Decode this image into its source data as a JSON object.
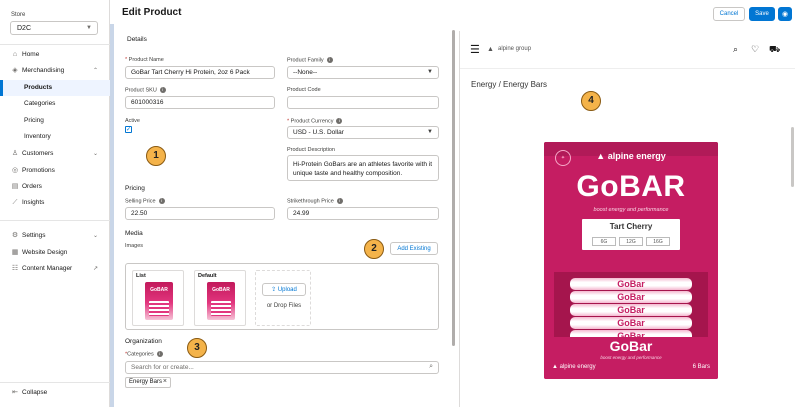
{
  "sidebar": {
    "store_label": "Store",
    "store_value": "D2C",
    "items": [
      {
        "label": "Home",
        "icon": "home-icon"
      },
      {
        "label": "Merchandising",
        "icon": "tag-icon"
      },
      {
        "label": "Customers",
        "icon": "people-icon"
      },
      {
        "label": "Promotions",
        "icon": "promotion-icon"
      },
      {
        "label": "Orders",
        "icon": "orders-icon"
      },
      {
        "label": "Insights",
        "icon": "chart-icon"
      },
      {
        "label": "Settings",
        "icon": "gear-icon"
      },
      {
        "label": "Website Design",
        "icon": "layout-icon"
      },
      {
        "label": "Content Manager",
        "icon": "content-icon"
      }
    ],
    "sub_items": [
      "Products",
      "Categories",
      "Pricing",
      "Inventory"
    ],
    "collapse_label": "Collapse"
  },
  "header": {
    "title": "Edit Product",
    "cancel_label": "Cancel",
    "save_label": "Save"
  },
  "details": {
    "section": "Details",
    "product_name_label": "Product Name",
    "product_name_value": "GoBar Tart Cherry Hi Protein, 2oz 6 Pack",
    "product_family_label": "Product Family",
    "product_family_value": "--None--",
    "product_sku_label": "Product SKU",
    "product_sku_value": "601000316",
    "product_code_label": "Product Code",
    "product_code_value": "",
    "active_label": "Active",
    "product_currency_label": "Product Currency",
    "product_currency_value": "USD - U.S. Dollar",
    "product_description_label": "Product Description",
    "product_description_value": "Hi-Protein GoBars are an athletes favorite with it unique taste and healthy composition."
  },
  "pricing": {
    "section": "Pricing",
    "selling_price_label": "Selling Price",
    "selling_price_value": "22.50",
    "strikethrough_price_label": "Strikethrough Price",
    "strikethrough_price_value": "24.99"
  },
  "media": {
    "section": "Media",
    "images_label": "Images",
    "add_existing_label": "Add Existing",
    "thumbs": [
      {
        "label": "List",
        "brand": "GoBAR"
      },
      {
        "label": "Default",
        "brand": "GoBAR"
      }
    ],
    "upload_label": "Upload",
    "drop_label": "or Drop Files"
  },
  "organization": {
    "section": "Organization",
    "categories_label": "Categories",
    "search_placeholder": "Search for or create...",
    "selected_category": "Energy Bars"
  },
  "callouts": [
    "1",
    "2",
    "3",
    "4"
  ],
  "preview": {
    "logo": "alpine group",
    "breadcrumb": "Energy / Energy Bars",
    "brand": "alpine energy",
    "product_name": "GoBAR",
    "tagline": "boost energy and performance",
    "flavor": "Tart Cherry",
    "stats": [
      "6G",
      "12G",
      "16G"
    ],
    "bar_label": "GoBar",
    "bar_tagline": "boost energy and performance",
    "front_brand": "alpine energy",
    "count": "6 Bars"
  },
  "colors": {
    "accent": "#0176d3",
    "product_pink": "#c51d62",
    "callout": "#f4b34a"
  }
}
